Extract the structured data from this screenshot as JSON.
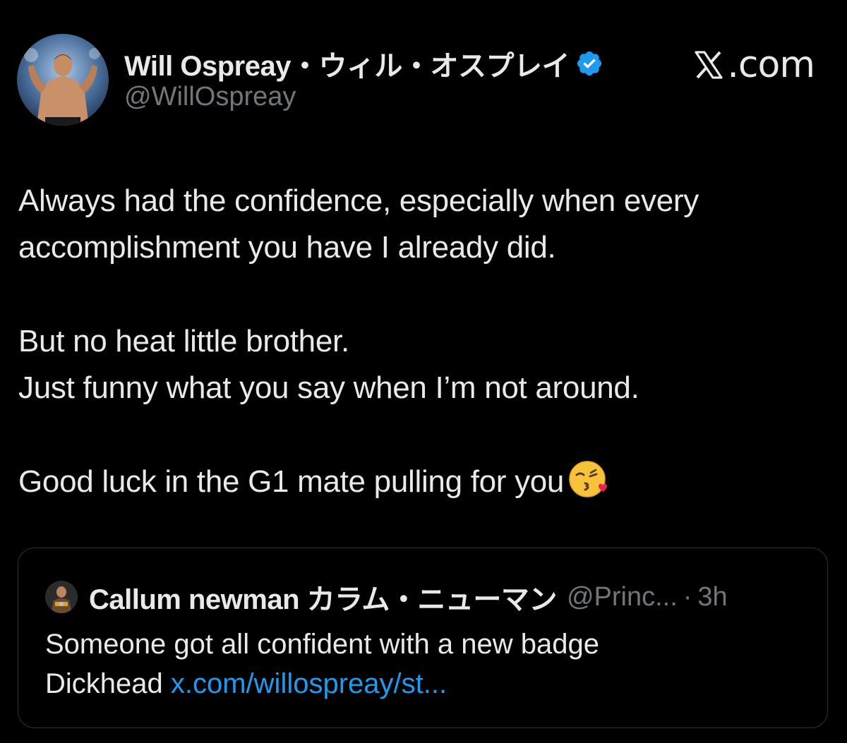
{
  "post": {
    "author_name": "Will Ospreay・ウィル・オスプレイ",
    "author_handle": "@WillOspreay",
    "verified_icon": "verified-badge-icon",
    "site_label": "X.com",
    "body_lines": [
      "Always had the confidence, especially when every",
      "accomplishment you have I already did.",
      "But no heat little brother.",
      "Just funny what you say when I’m not around.",
      "Good luck in the G1 mate pulling for you"
    ],
    "emoji": "face-blowing-a-kiss-icon"
  },
  "quoted_post": {
    "author_name": "Callum newman カラム・ニューマン",
    "author_handle": "@Princ...",
    "separator": "·",
    "time": "3h",
    "text_line1": "Someone got all confident with a new badge",
    "text_line2_prefix": "Dickhead ",
    "link": "x.com/willospreay/st..."
  },
  "colors": {
    "background": "#000000",
    "primary_text": "#e7e9ea",
    "secondary_text": "#71767b",
    "link": "#1d9bf0",
    "verified": "#1d9bf0",
    "card_border": "#2f3336"
  }
}
